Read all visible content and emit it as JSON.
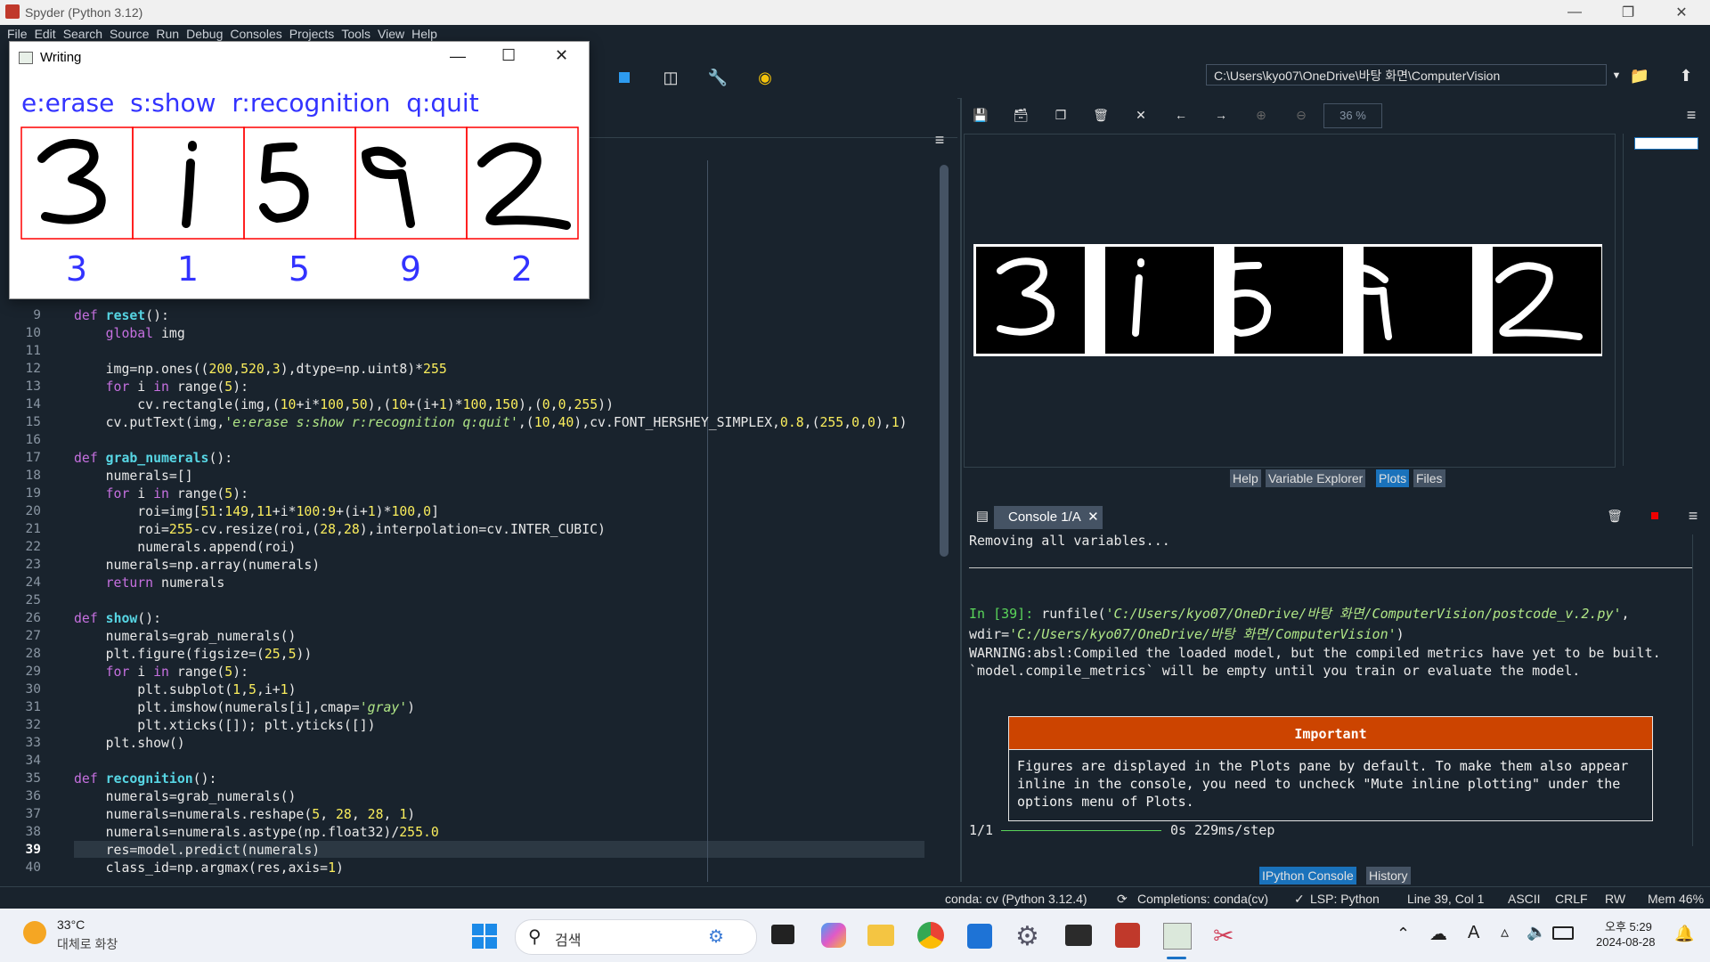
{
  "spyder": {
    "title": "Spyder (Python 3.12)",
    "menu": [
      "File",
      "Edit",
      "Search",
      "Source",
      "Run",
      "Debug",
      "Consoles",
      "Projects",
      "Tools",
      "View",
      "Help"
    ],
    "working_dir": "C:\\Users\\kyo07\\OneDrive\\바탕 화면\\ComputerVision"
  },
  "editor": {
    "line_numbers": [
      "9",
      "10",
      "11",
      "12",
      "13",
      "14",
      "15",
      "16",
      "17",
      "18",
      "19",
      "20",
      "21",
      "22",
      "23",
      "24",
      "25",
      "26",
      "27",
      "28",
      "29",
      "30",
      "31",
      "32",
      "33",
      "34",
      "35",
      "36",
      "37",
      "38",
      "39",
      "40"
    ],
    "current_line": "39"
  },
  "writing_window": {
    "title": "Writing",
    "instructions": "e:erase  s:show  r:recognition  q:quit",
    "predictions": [
      "3",
      "1",
      "5",
      "9",
      "2"
    ]
  },
  "plots": {
    "zoom": "36 %",
    "tabs": [
      "Help",
      "Variable Explorer",
      "Plots",
      "Files"
    ],
    "active_tab": "Plots"
  },
  "console": {
    "tab_label": "Console 1/A",
    "line1": "Removing all variables...",
    "prompt": "In [39]:",
    "run_cmd": " runfile(",
    "run_path": "'C:/Users/kyo07/OneDrive/바탕 화면/ComputerVision/postcode_v.2.py'",
    "run_sep": ",",
    "wdir_label": "wdir=",
    "wdir_path": "'C:/Users/kyo07/OneDrive/바탕 화면/ComputerVision'",
    "wdir_close": ")",
    "warning1": "WARNING:absl:Compiled the loaded model, but the compiled metrics have yet to be built.",
    "warning2": "`model.compile_metrics` will be empty until you train or evaluate the model.",
    "important_title": "Important",
    "important_body": "Figures are displayed in the Plots pane by default. To make them also appear\ninline in the console, you need to uncheck \"Mute inline plotting\" under the\noptions menu of Plots.",
    "progress_count": "1/1",
    "progress_text": "0s 229ms/step",
    "progress_value": 1.0,
    "tabs": [
      "IPython Console",
      "History"
    ],
    "active_tab": "IPython Console"
  },
  "status": {
    "conda": "conda: cv (Python 3.12.4)",
    "completions": "Completions: conda(cv)",
    "lsp": "LSP: Python",
    "position": "Line 39, Col 1",
    "encoding": "ASCII",
    "eol": "CRLF",
    "rw": "RW",
    "mem": "Mem 46%"
  },
  "taskbar": {
    "weather_temp": "33°C",
    "weather_desc": "대체로 화창",
    "search_placeholder": "검색",
    "time": "오후 5:29",
    "date": "2024-08-28"
  },
  "colors": {
    "bg": "#19232d",
    "accent": "#1a72bb",
    "important": "#cc4400",
    "digit_label": "#3333ff",
    "box": "#ff0000"
  }
}
